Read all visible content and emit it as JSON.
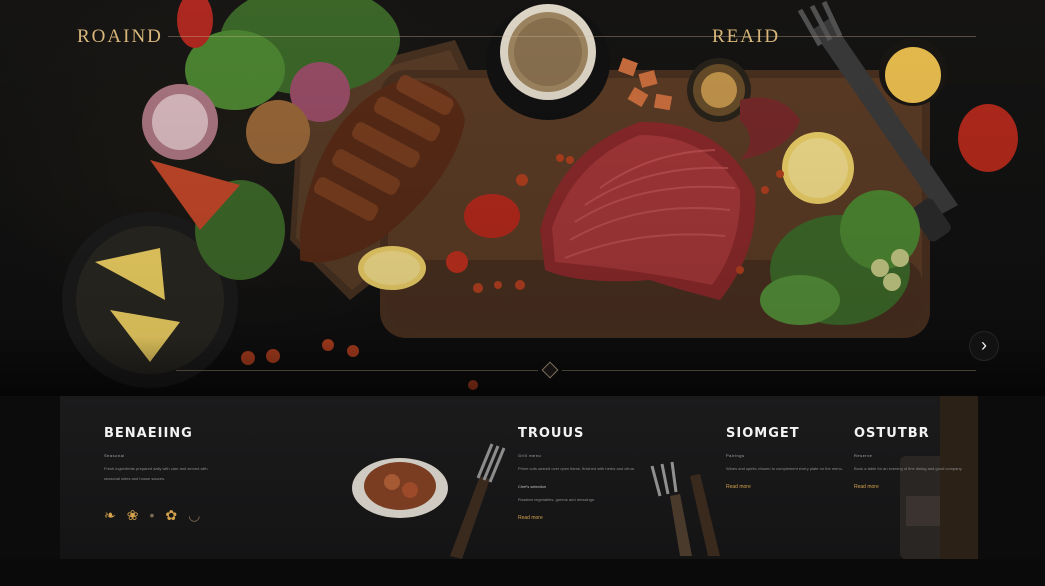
{
  "hero": {
    "brand_left": "ROAIND",
    "brand_right": "REAID",
    "next_button": "›"
  },
  "lower": {
    "columns": [
      {
        "title": "BENAEIING",
        "subtitle": "Seasonal",
        "body": "Fresh ingredients prepared daily with care and served with seasonal sides and house sauces.",
        "link": ""
      },
      {
        "title": "TROUUS",
        "subtitle": "Grill menu",
        "body": "Prime cuts seared over open flame, finished with herbs and citrus.",
        "heading2": "Chef's selection",
        "body2": "Roasted vegetables, greens and dressings.",
        "link": "Read more"
      },
      {
        "title": "SIOMGET",
        "subtitle": "Pairings",
        "body": "Wines and spirits chosen to complement every plate on the menu.",
        "link": "Read more"
      },
      {
        "title": "OSTUTBR",
        "subtitle": "Reserve",
        "body": "Book a table for an evening of fine dining and good company.",
        "link": "Read more"
      }
    ],
    "icons": [
      "leaf-icon",
      "flame-icon",
      "drop-icon",
      "pepper-icon",
      "bowl-icon"
    ]
  }
}
